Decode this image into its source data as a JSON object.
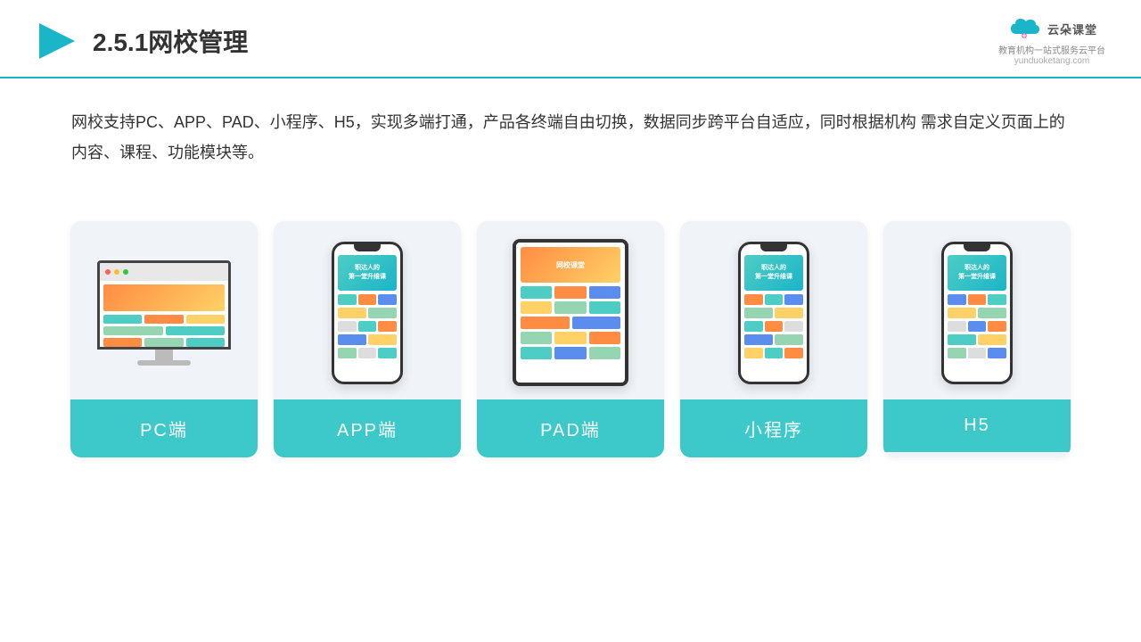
{
  "header": {
    "title": "2.5.1网校管理",
    "logo": {
      "text": "云朵课堂",
      "subtitle": "教育机构一站\n式服务云平台",
      "domain": "yunduoketang.com"
    }
  },
  "description": "网校支持PC、APP、PAD、小程序、H5，实现多端打通，产品各终端自由切换，数据同步跨平台自适应，同时根据机构\n需求自定义页面上的内容、课程、功能模块等。",
  "cards": [
    {
      "id": "pc",
      "label": "PC端",
      "type": "pc"
    },
    {
      "id": "app",
      "label": "APP端",
      "type": "phone"
    },
    {
      "id": "pad",
      "label": "PAD端",
      "type": "tablet"
    },
    {
      "id": "miniapp",
      "label": "小程序",
      "type": "phone"
    },
    {
      "id": "h5",
      "label": "H5",
      "type": "phone"
    }
  ]
}
